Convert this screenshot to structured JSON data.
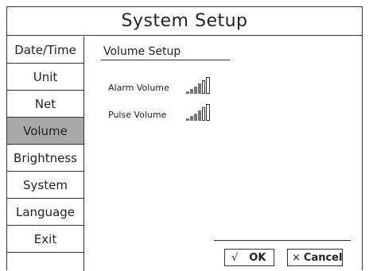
{
  "header": {
    "title": "System Setup"
  },
  "sidebar": {
    "items": [
      {
        "label": "Date/Time",
        "active": false
      },
      {
        "label": "Unit",
        "active": false
      },
      {
        "label": "Net",
        "active": false
      },
      {
        "label": "Volume",
        "active": true
      },
      {
        "label": "Brightness",
        "active": false
      },
      {
        "label": "System",
        "active": false
      },
      {
        "label": "Language",
        "active": false
      },
      {
        "label": "Exit",
        "active": false
      }
    ]
  },
  "volume_setup": {
    "title": "Volume Setup",
    "alarm": {
      "label": "Alarm Volume",
      "level": 4,
      "max": 5
    },
    "pulse": {
      "label": "Pulse Volume",
      "level": 4,
      "max": 5
    }
  },
  "buttons": {
    "ok": {
      "glyph": "√",
      "label": "OK"
    },
    "cancel": {
      "glyph": "×",
      "label": "Cancel"
    }
  },
  "colors": {
    "active_bg": "#a8a8a8",
    "bar_filled": "#777777",
    "border": "#333333"
  }
}
